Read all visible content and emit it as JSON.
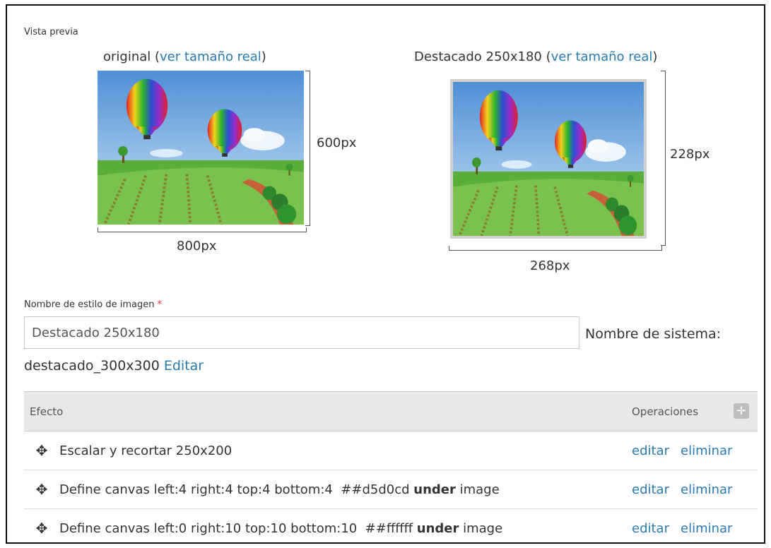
{
  "preview": {
    "label": "Vista previa",
    "original": {
      "title": "original",
      "link": "ver tamaño real",
      "width_label": "800px",
      "height_label": "600px"
    },
    "derived": {
      "title": "Destacado 250x180",
      "link": "ver tamaño real",
      "width_label": "268px",
      "height_label": "228px"
    }
  },
  "form": {
    "name_label": "Nombre de estilo de imagen",
    "required_mark": "*",
    "name_value": "Destacado 250x180",
    "system_label": "Nombre de sistema:",
    "machine_name": "destacado_300x300",
    "edit_link": "Editar"
  },
  "effects": {
    "col_effect": "Efecto",
    "col_operations": "Operaciones",
    "rows": [
      {
        "pre": "Escalar y recortar 250x200",
        "bold": "",
        "post": "",
        "edit": "editar",
        "delete": "eliminar"
      },
      {
        "pre": "Define canvas left:4 right:4 top:4 bottom:4  ##d5d0cd ",
        "bold": "under",
        "post": " image",
        "edit": "editar",
        "delete": "eliminar"
      },
      {
        "pre": "Define canvas left:0 right:10 top:10 bottom:10  ##ffffff ",
        "bold": "under",
        "post": " image",
        "edit": "editar",
        "delete": "eliminar"
      }
    ]
  },
  "colors": {
    "link": "#2a7ab0",
    "required": "#e0242c",
    "canvas_border": "#d5d0cd"
  }
}
